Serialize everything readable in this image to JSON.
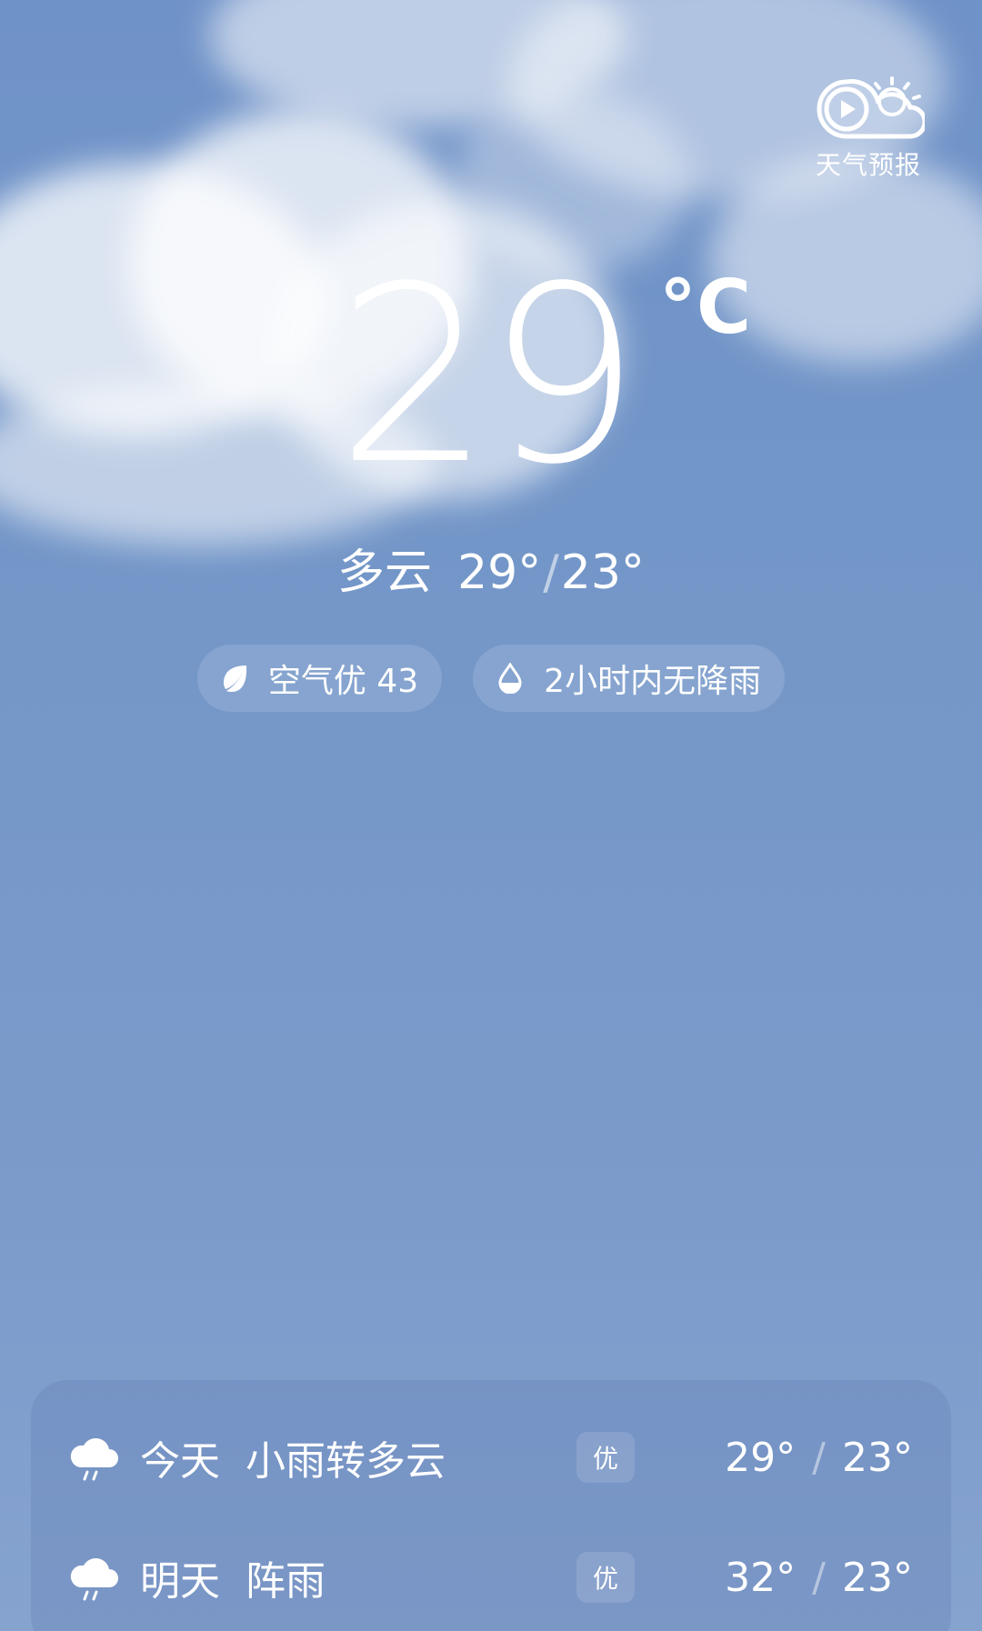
{
  "video_forecast": {
    "label": "天气预报",
    "icon": "video-forecast-icon"
  },
  "current": {
    "temperature": "29",
    "unit": "°C",
    "condition": "多云",
    "high": "29°",
    "low": "23°"
  },
  "pills": {
    "air": {
      "icon": "leaf-icon",
      "label": "空气优 43"
    },
    "rain": {
      "icon": "drop-icon",
      "label": "2小时内无降雨"
    }
  },
  "forecast": [
    {
      "icon": "rain-cloud-icon",
      "day": "今天",
      "desc": "小雨转多云",
      "aqi": "优",
      "high": "29°",
      "low": "23°"
    },
    {
      "icon": "rain-cloud-icon",
      "day": "明天",
      "desc": "阵雨",
      "aqi": "优",
      "high": "32°",
      "low": "23°"
    }
  ],
  "colors": {
    "sky_top": "#6f92c8",
    "sky_bottom": "#86a3cf"
  }
}
